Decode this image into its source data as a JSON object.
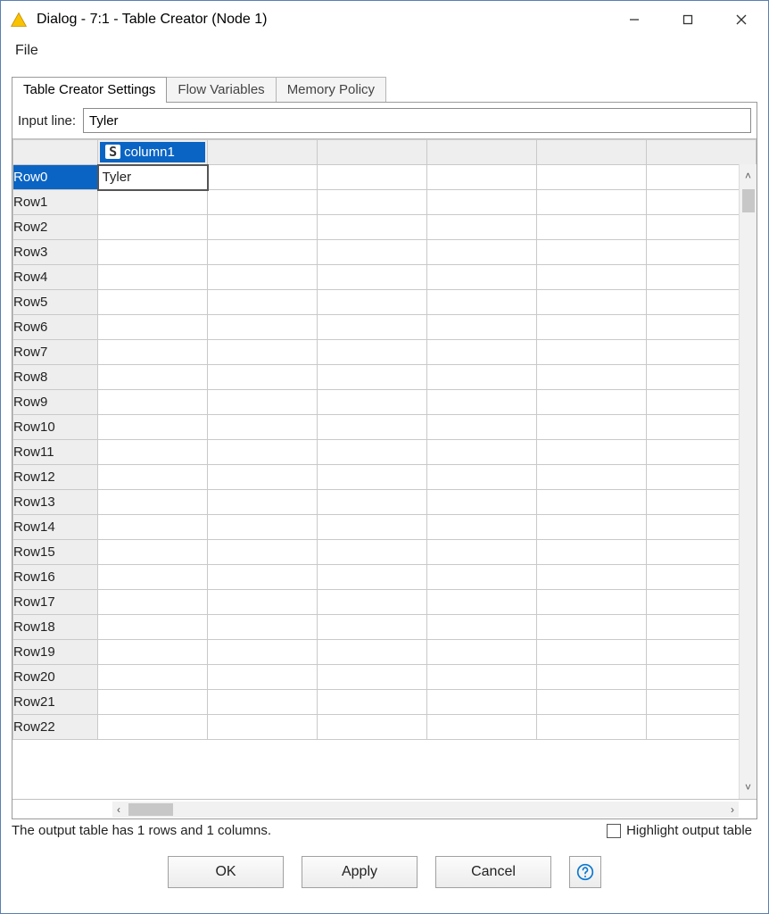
{
  "window": {
    "title": "Dialog - 7:1 - Table Creator (Node 1)"
  },
  "menu": {
    "file": "File"
  },
  "tabs": {
    "settings": "Table Creator Settings",
    "flowvars": "Flow Variables",
    "memory": "Memory Policy"
  },
  "inputline": {
    "label": "Input line:",
    "value": "Tyler"
  },
  "table": {
    "column_type_badge": "S",
    "column_name": "column1",
    "row_headers": [
      "Row0",
      "Row1",
      "Row2",
      "Row3",
      "Row4",
      "Row5",
      "Row6",
      "Row7",
      "Row8",
      "Row9",
      "Row10",
      "Row11",
      "Row12",
      "Row13",
      "Row14",
      "Row15",
      "Row16",
      "Row17",
      "Row18",
      "Row19",
      "Row20",
      "Row21",
      "Row22"
    ],
    "cells_col1": [
      "Tyler",
      "",
      "",
      "",
      "",
      "",
      "",
      "",
      "",
      "",
      "",
      "",
      "",
      "",
      "",
      "",
      "",
      "",
      "",
      "",
      "",
      "",
      ""
    ],
    "selected_row_index": 0,
    "editing_row_index": 0
  },
  "status": {
    "text": "The output table has 1 rows and 1 columns.",
    "highlight_label": "Highlight output table",
    "highlight_checked": false
  },
  "buttons": {
    "ok": "OK",
    "apply": "Apply",
    "cancel": "Cancel"
  }
}
